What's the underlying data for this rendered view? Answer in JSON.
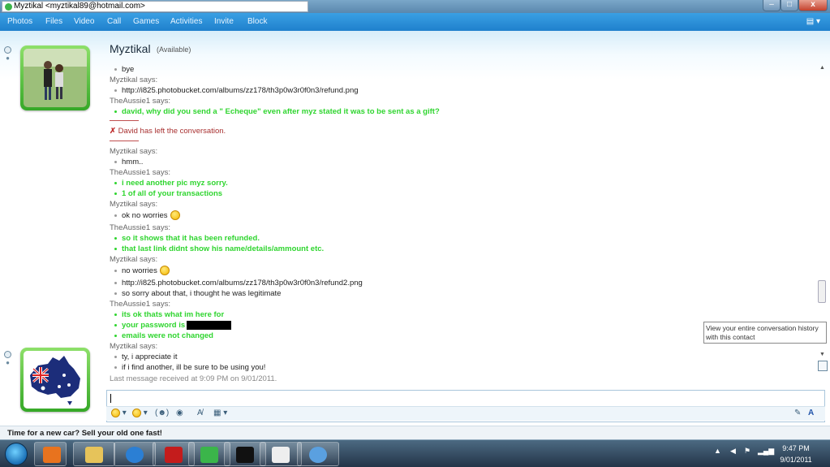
{
  "window": {
    "title": "Myztikal <myztikal89@hotmail.com>",
    "minimize": "–",
    "maximize": "□",
    "close": "x"
  },
  "menu": {
    "items": [
      "Photos",
      "Files",
      "Video",
      "Call",
      "Games",
      "Activities",
      "Invite",
      "Block"
    ],
    "right_icon": "menu-icon"
  },
  "contact": {
    "name": "Myztikal",
    "status": "(Available)"
  },
  "conversation": [
    {
      "type": "msg",
      "text": "bye",
      "style": "plain"
    },
    {
      "type": "says",
      "text": "Myztikal says:"
    },
    {
      "type": "msg",
      "text": "http://i825.photobucket.com/albums/zz178/th3p0w3r0f0n3/refund.png",
      "style": "plain"
    },
    {
      "type": "says",
      "text": "TheAussie1 says:"
    },
    {
      "type": "msg",
      "text": "david, why did you send a \" Echeque\" even after myz stated it was to be sent as a gift?",
      "style": "green"
    },
    {
      "type": "event",
      "text": "David has left the conversation."
    },
    {
      "type": "says",
      "text": "Myztikal says:"
    },
    {
      "type": "msg",
      "text": "hmm..",
      "style": "plain"
    },
    {
      "type": "says",
      "text": "TheAussie1 says:"
    },
    {
      "type": "msg",
      "text": "i need another pic myz sorry.",
      "style": "green"
    },
    {
      "type": "msg",
      "text": "1 of all of your transactions",
      "style": "green"
    },
    {
      "type": "says",
      "text": "Myztikal says:"
    },
    {
      "type": "msg",
      "text": "ok no worries",
      "style": "plain",
      "smiley": true
    },
    {
      "type": "says",
      "text": "TheAussie1 says:"
    },
    {
      "type": "msg",
      "text": "so it shows that it has been refunded.",
      "style": "green"
    },
    {
      "type": "msg",
      "text": "that last link didnt show his name/details/ammount etc.",
      "style": "green"
    },
    {
      "type": "says",
      "text": "Myztikal says:"
    },
    {
      "type": "msg",
      "text": "no worries",
      "style": "plain",
      "smiley": true
    },
    {
      "type": "msg",
      "text": "http://i825.photobucket.com/albums/zz178/th3p0w3r0f0n3/refund2.png",
      "style": "plain"
    },
    {
      "type": "msg",
      "text": "so sorry about that, i thought he was legitimate",
      "style": "plain"
    },
    {
      "type": "says",
      "text": "TheAussie1 says:"
    },
    {
      "type": "msg",
      "text": "its ok thats what im here for",
      "style": "green"
    },
    {
      "type": "msg",
      "text": "your password is",
      "style": "green",
      "redacted": true
    },
    {
      "type": "msg",
      "text": "emails were not changed",
      "style": "green"
    },
    {
      "type": "says",
      "text": "Myztikal says:"
    },
    {
      "type": "msg",
      "text": "ty, i appreciate it",
      "style": "plain"
    },
    {
      "type": "msg",
      "text": "if i find another, ill be sure to be using you!",
      "style": "plain"
    }
  ],
  "last_message": "Last message received at 9:09 PM on 9/01/2011.",
  "tooltip": "View your entire conversation history with this contact",
  "ad": "Time for a new car? Sell your old one fast!",
  "clock": {
    "time": "9:47 PM",
    "date": "9/01/2011"
  },
  "colors": {
    "green_text": "#2fd52f",
    "menu_bar": "#2a8fd8",
    "event_text": "#a83030"
  }
}
